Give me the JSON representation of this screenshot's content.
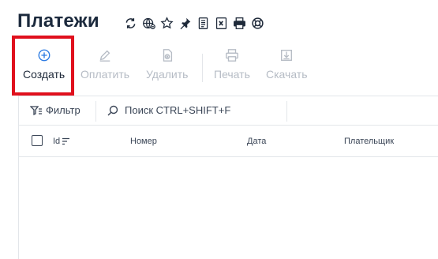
{
  "page": {
    "title": "Платежи"
  },
  "title_icons": [
    "refresh-icon",
    "globe-icon",
    "star-icon",
    "pin-icon",
    "document-icon",
    "excel-icon",
    "printer-icon",
    "lifebuoy-icon"
  ],
  "toolbar": {
    "create_label": "Создать",
    "pay_label": "Оплатить",
    "delete_label": "Удалить",
    "print_label": "Печать",
    "download_label": "Скачать"
  },
  "filterbar": {
    "filter_label": "Фильтр",
    "search_placeholder": "Поиск CTRL+SHIFT+F"
  },
  "table": {
    "columns": [
      "Id",
      "Номер",
      "Дата",
      "Плательщик"
    ]
  },
  "colors": {
    "accent": "#2a7ae2",
    "highlight": "#e0101d",
    "disabled": "#b6bcc5"
  }
}
